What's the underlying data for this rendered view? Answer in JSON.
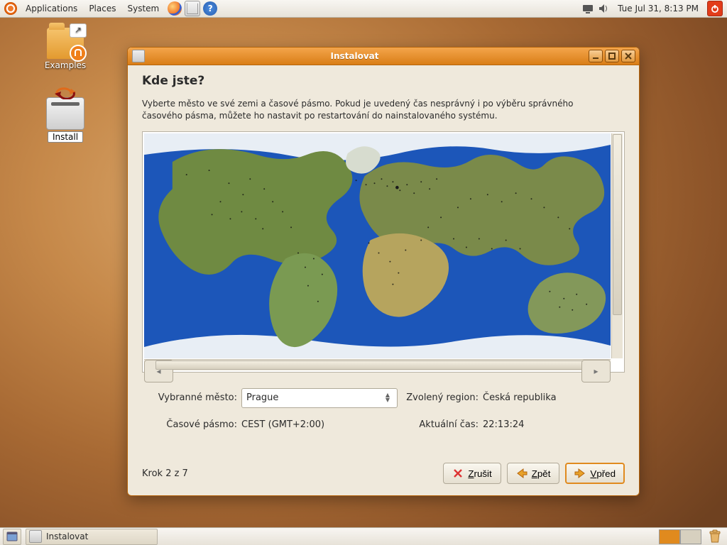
{
  "panel": {
    "menus": {
      "apps": "Applications",
      "places": "Places",
      "system": "System"
    },
    "clock": "Tue Jul 31,  8:13 PM"
  },
  "desktop": {
    "examples": "Examples",
    "install": "Install"
  },
  "window": {
    "title": "Instalovat",
    "heading": "Kde jste?",
    "description": "Vyberte město ve své zemi a časové pásmo. Pokud je uvedený čas nesprávný i po výběru správného časového pásma, můžete ho nastavit po restartování do nainstalovaného systému.",
    "labels": {
      "selected_city": "Vybranné město:",
      "selected_region": "Zvolený region:",
      "timezone": "Časové pásmo:",
      "current_time": "Aktuální čas:"
    },
    "values": {
      "city": "Prague",
      "region": "Česká republika",
      "timezone": "CEST (GMT+2:00)",
      "time": "22:13:24"
    },
    "step": "Krok 2 z 7",
    "buttons": {
      "cancel": "Zrušit",
      "back": "Zpět",
      "forward": "Vpřed"
    }
  },
  "taskbar": {
    "task1": "Instalovat"
  }
}
